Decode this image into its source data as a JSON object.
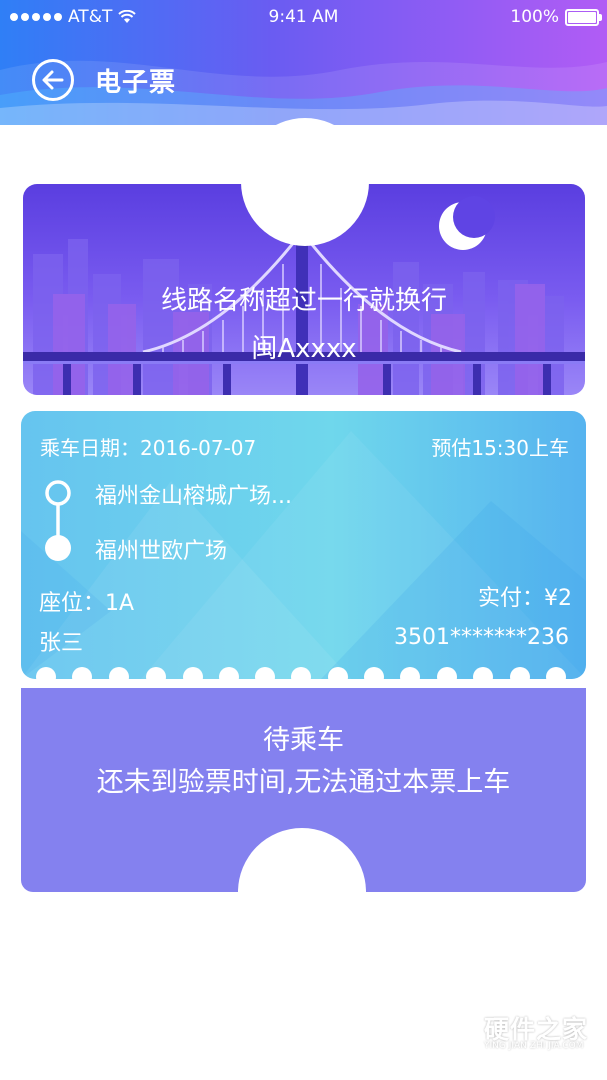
{
  "status_bar": {
    "carrier": "AT&T",
    "time": "9:41 AM",
    "battery": "100%"
  },
  "header": {
    "title": "电子票",
    "back_icon": "back-arrow-icon"
  },
  "route": {
    "name": "线路名称超过一行就换行",
    "plate": "闽Axxxx"
  },
  "ticket": {
    "ride_date": "乘车日期：2016-07-07",
    "eta": "预估15:30上车",
    "from_stop": "福州金山榕城广场...",
    "to_stop": "福州世欧广场",
    "seat": "座位：1A",
    "paid": "实付：¥2",
    "passenger": "张三",
    "id_number": "3501*******236"
  },
  "state": {
    "title": "待乘车",
    "message": "还未到验票时间,无法通过本票上车"
  },
  "watermark": {
    "main": "硬件之家",
    "sub": "YING JIAN ZHI JIA.COM"
  },
  "colors": {
    "header_start": "#2f7ff6",
    "header_end": "#b15cf5",
    "route_card": "#6a4ee8",
    "ticket_card": "#6fd7ec",
    "status_card": "#8481ef"
  }
}
